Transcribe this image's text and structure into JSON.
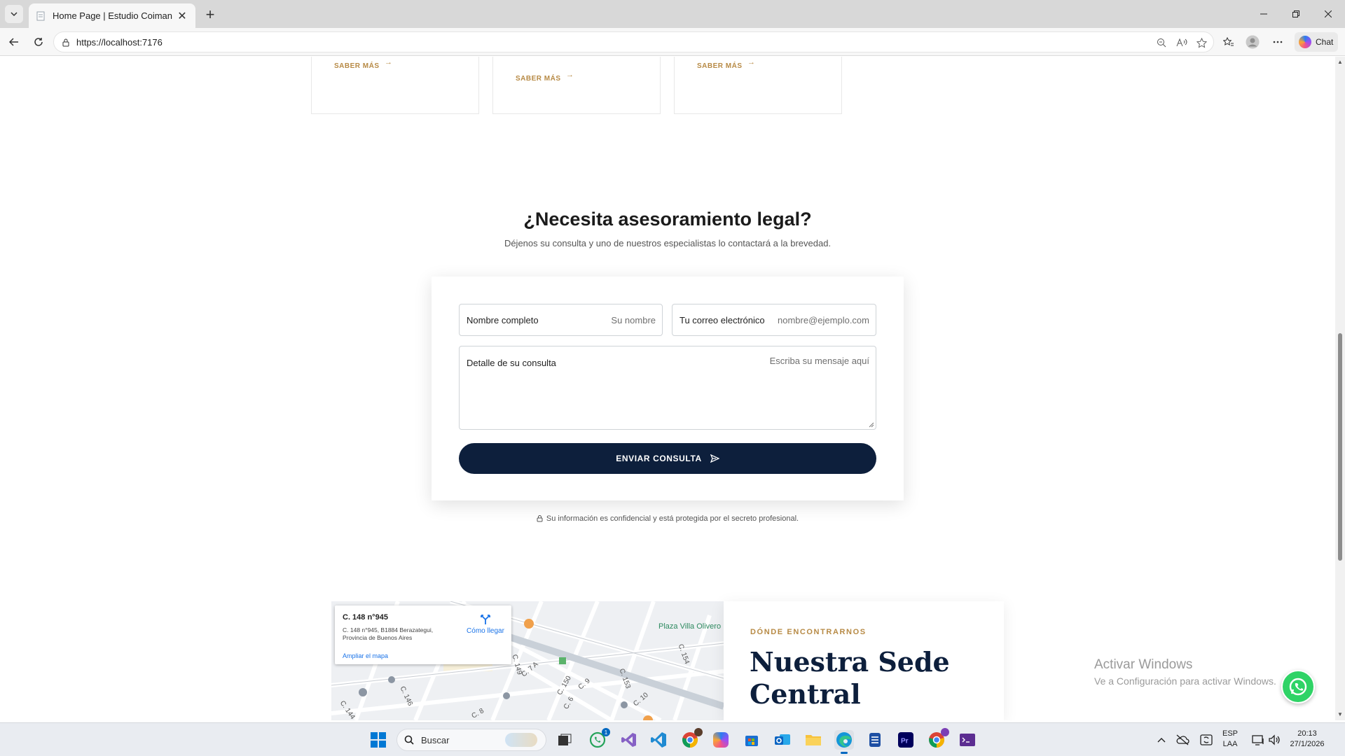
{
  "browser": {
    "tab_title": "Home Page | Estudio Coiman",
    "url": "https://localhost:7176",
    "chat_label": "Chat"
  },
  "cards": [
    {
      "link": "SABER MÁS"
    },
    {
      "link": "SABER MÁS"
    },
    {
      "link": "SABER MÁS"
    }
  ],
  "contact": {
    "title": "¿Necesita asesoramiento legal?",
    "subtitle": "Déjenos su consulta y uno de nuestros especialistas lo contactará a la brevedad.",
    "name_label": "Nombre completo",
    "name_placeholder": "Su nombre",
    "email_label": "Tu correo electrónico",
    "email_placeholder": "nombre@ejemplo.com",
    "message_label": "Detalle de su consulta",
    "message_placeholder": "Escriba su mensaje aquí",
    "submit_label": "ENVIAR CONSULTA",
    "privacy_note": "Su información es confidencial y está protegida por el secreto profesional."
  },
  "map": {
    "place_title": "C. 148 n°945",
    "place_address": "C. 148 n°945, B1884 Berazategui, Provincia de Buenos Aires",
    "directions_label": "Cómo llegar",
    "expand_label": "Ampliar el mapa",
    "poi_label": "Plaza Villa Olivero",
    "streets": [
      "C. 7 A",
      "C. 150",
      "C. 149",
      "C. 153",
      "C. 154",
      "C. 9",
      "C. 8",
      "C. 146",
      "C. 144",
      "C. 10",
      "C. 6"
    ]
  },
  "location": {
    "eyebrow": "DÓNDE ENCONTRARNOS",
    "heading": "Nuestra Sede Central"
  },
  "windows_watermark": {
    "line1": "Activar Windows",
    "line2": "Ve a Configuración para activar Windows."
  },
  "taskbar": {
    "search_placeholder": "Buscar",
    "whatsapp_badge": "1",
    "language_top": "ESP",
    "language_bottom": "LAA",
    "time": "20:13",
    "date": "27/1/2026"
  },
  "colors": {
    "accent_gold": "#b78a45",
    "navy": "#0d1f3c",
    "whatsapp_green": "#2fd366"
  }
}
